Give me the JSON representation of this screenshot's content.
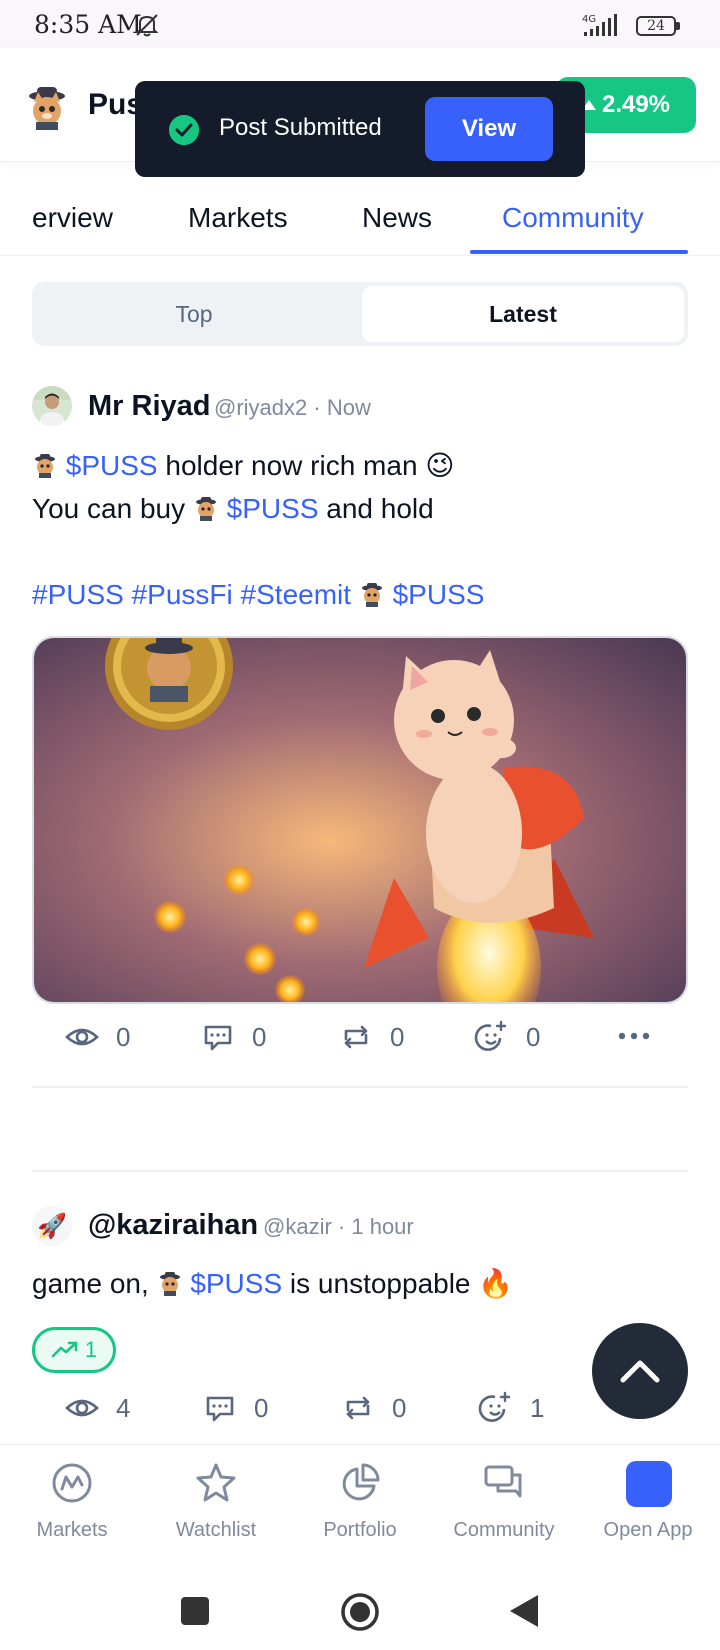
{
  "status_bar": {
    "time": "8:35 AM",
    "battery": "24",
    "network": "4G"
  },
  "header": {
    "coin_name": "Pus",
    "price_change": "2.49%"
  },
  "toast": {
    "message": "Post Submitted",
    "action": "View"
  },
  "tabs": [
    {
      "label": "erview"
    },
    {
      "label": "Markets"
    },
    {
      "label": "News"
    },
    {
      "label": "Community",
      "active": true
    }
  ],
  "segments": {
    "top": "Top",
    "latest": "Latest",
    "selected": "Latest"
  },
  "posts": [
    {
      "author": "Mr Riyad",
      "handle": "@riyadx2",
      "time": "· Now",
      "line1_text": "holder now rich man",
      "line1_emoji": "😉",
      "line2_prefix": "You can buy",
      "line2_suffix": "and hold",
      "ticker": "$PUSS",
      "hashtags": [
        "#PUSS",
        "#PussFi",
        "#Steemit"
      ],
      "stats": {
        "views": "0",
        "comments": "0",
        "reposts": "0",
        "reactions": "0"
      }
    },
    {
      "author": "@kaziraihan",
      "handle": "@kazir",
      "time": "· 1 hour",
      "text_prefix": "game on,",
      "ticker": "$PUSS",
      "text_suffix": "is unstoppable",
      "emoji": "🔥",
      "avatar_emoji": "🚀",
      "trend_count": "1",
      "stats": {
        "views": "4",
        "comments": "0",
        "reposts": "0",
        "reactions": "1"
      }
    }
  ],
  "bottom_nav": [
    {
      "label": "Markets"
    },
    {
      "label": "Watchlist"
    },
    {
      "label": "Portfolio"
    },
    {
      "label": "Community"
    },
    {
      "label": "Open App"
    }
  ],
  "colors": {
    "accent": "#3861fb",
    "green": "#16c784",
    "toast_bg": "#141b2a",
    "text": "#0d1421",
    "muted": "#808a9d"
  }
}
